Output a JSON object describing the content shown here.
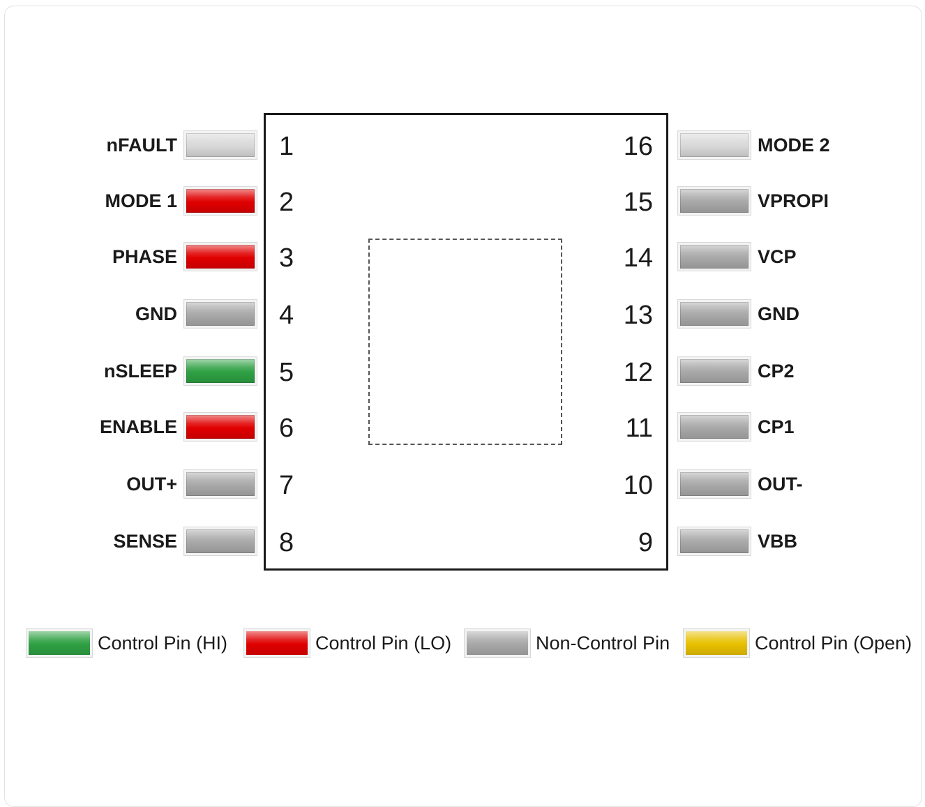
{
  "colors": {
    "hi": "#2ea043",
    "lo": "#e00000",
    "noncontrol": "#a8a8a8",
    "open": "#e8c000",
    "off": "#d8d8d8"
  },
  "pins_left": [
    {
      "num": "1",
      "name": "nFAULT",
      "state": "off"
    },
    {
      "num": "2",
      "name": "MODE 1",
      "state": "lo"
    },
    {
      "num": "3",
      "name": "PHASE",
      "state": "lo"
    },
    {
      "num": "4",
      "name": "GND",
      "state": "noncontrol"
    },
    {
      "num": "5",
      "name": "nSLEEP",
      "state": "hi"
    },
    {
      "num": "6",
      "name": "ENABLE",
      "state": "lo"
    },
    {
      "num": "7",
      "name": "OUT+",
      "state": "noncontrol"
    },
    {
      "num": "8",
      "name": "SENSE",
      "state": "noncontrol"
    }
  ],
  "pins_right": [
    {
      "num": "16",
      "name": "MODE 2",
      "state": "off"
    },
    {
      "num": "15",
      "name": "VPROPI",
      "state": "noncontrol"
    },
    {
      "num": "14",
      "name": "VCP",
      "state": "noncontrol"
    },
    {
      "num": "13",
      "name": "GND",
      "state": "noncontrol"
    },
    {
      "num": "12",
      "name": "CP2",
      "state": "noncontrol"
    },
    {
      "num": "11",
      "name": "CP1",
      "state": "noncontrol"
    },
    {
      "num": "10",
      "name": "OUT-",
      "state": "noncontrol"
    },
    {
      "num": "9",
      "name": "VBB",
      "state": "noncontrol"
    }
  ],
  "legend": [
    {
      "label": "Control Pin (HI)",
      "state": "hi"
    },
    {
      "label": "Control Pin (LO)",
      "state": "lo"
    },
    {
      "label": "Non-Control Pin",
      "state": "noncontrol"
    },
    {
      "label": "Control Pin (Open)",
      "state": "open"
    }
  ]
}
